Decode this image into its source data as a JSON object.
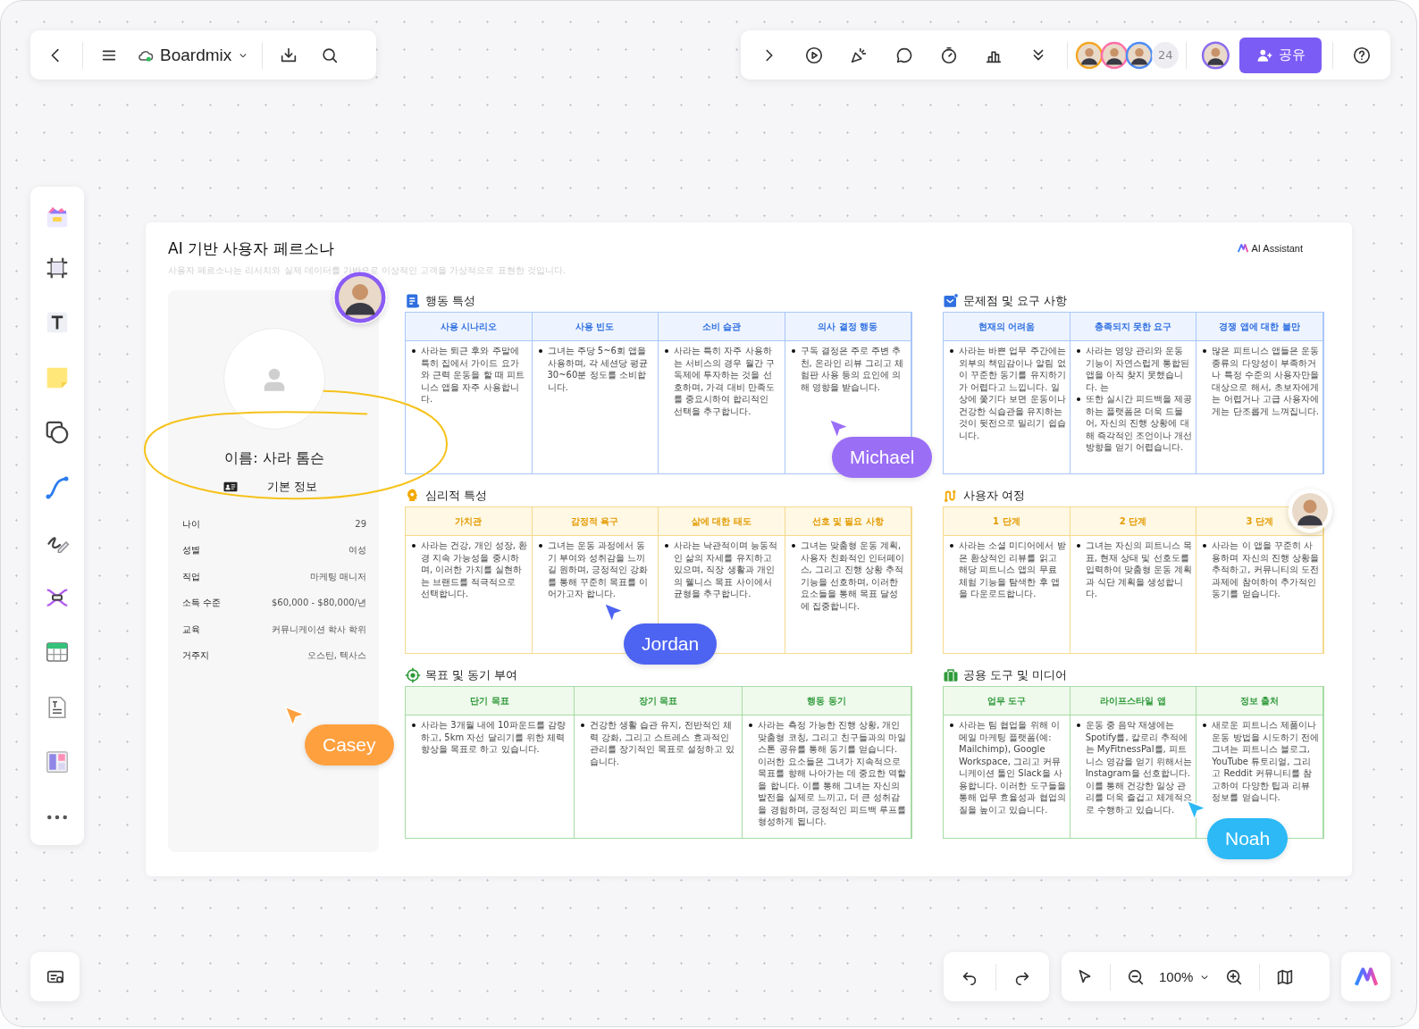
{
  "top_toolbar": {
    "board_name": "Boardmix"
  },
  "collab_bar": {
    "collaborator_count": "24",
    "share_label": "공유"
  },
  "board": {
    "title": "AI 기반 사용자 페르소나",
    "subtitle": "사용자 페르소나는 리서치와 실제 데이터를 기반으로 이상적인 고객을 가상적으로 표현한 것입니다.",
    "assistant_label": "AI Assistant",
    "profile": {
      "name": "이름: 사라 톰슨",
      "section_label": "기본 정보",
      "fields": [
        {
          "label": "나이",
          "value": "29"
        },
        {
          "label": "성별",
          "value": "여성"
        },
        {
          "label": "직업",
          "value": "마케팅 매니저"
        },
        {
          "label": "소득 수준",
          "value": "$60,000 - $80,000/년"
        },
        {
          "label": "교육",
          "value": "커뮤니케이션 학사 학위"
        },
        {
          "label": "거주지",
          "value": "오스틴, 텍사스"
        }
      ]
    },
    "sections": [
      {
        "title": "행동 특성",
        "columns": [
          {
            "heading": "사용 시나리오",
            "bullets": [
              "사라는 퇴근 후와 주말에 특히 집에서 가이드 요가와 근력 운동을 할 때 피트니스 앱을 자주 사용합니다."
            ]
          },
          {
            "heading": "사용 빈도",
            "bullets": [
              "그녀는 주당 5~6회 앱을 사용하며, 각 세션당 평균 30~60분 정도를 소비합니다."
            ]
          },
          {
            "heading": "소비 습관",
            "bullets": [
              "사라는 특히 자주 사용하는 서비스의 경우 월간 구독제에 투자하는 것을 선호하며, 가격 대비 만족도를 중요시하여 합리적인 선택을 추구합니다."
            ]
          },
          {
            "heading": "의사 결정 행동",
            "bullets": [
              "구독 결정은 주로 주변 추천, 온라인 리뷰 그리고 체험판 사용 등의 요인에 의해 영향을 받습니다."
            ]
          }
        ]
      },
      {
        "title": "문제점 및 요구 사항",
        "columns": [
          {
            "heading": "현재의 어려움",
            "bullets": [
              "사라는 바쁜 업무 주간에는 외부의 책임감이나 알림 없이 꾸준한 동기를 유지하기가 어렵다고 느낍니다. 일상에 쫓기다 보면 운동이나 건강한 식습관을 유지하는 것이 뒷전으로 밀리기 쉽습니다."
            ]
          },
          {
            "heading": "충족되지 못한 요구",
            "bullets": [
              "사라는 영양 관리와 운동 기능이 자연스럽게 통합된 앱을 아직 찾지 못했습니다. 는",
              "또한 실시간 피드백을 제공하는 플랫폼은 더욱 드물어, 자신의 진행 상황에 대해 즉각적인 조언이나 개선 방향을 얻기 어렵습니다."
            ]
          },
          {
            "heading": "경쟁 앱에 대한 불만",
            "bullets": [
              "많은 피트니스 앱들은 운동 종류의 다양성이 부족하거나 특정 수준의 사용자만을 대상으로 해서, 초보자에게는 어렵거나 고급 사용자에게는 단조롭게 느껴집니다."
            ]
          }
        ]
      },
      {
        "title": "심리적 특성",
        "columns": [
          {
            "heading": "가치관",
            "bullets": [
              "사라는 건강, 개인 성장, 환경 지속 가능성을 중시하며, 이러한 가치를 실현하는 브랜드를 적극적으로 선택합니다."
            ]
          },
          {
            "heading": "감정적 욕구",
            "bullets": [
              "그녀는 운동 과정에서 동기 부여와 성취감을 느끼길 원하며, 긍정적인 강화를 통해 꾸준히 목표를 이어가고자 합니다."
            ]
          },
          {
            "heading": "삶에 대한 태도",
            "bullets": [
              "사라는 낙관적이며 능동적인 삶의 자세를 유지하고 있으며, 직장 생활과 개인의 웰니스 목표 사이에서 균형을 추구합니다."
            ]
          },
          {
            "heading": "선호 및 필요 사항",
            "bullets": [
              "그녀는 맞춤형 운동 계획, 사용자 친화적인 인터페이스, 그리고 진행 상황 추적 기능을 선호하며, 이러한 요소들을 통해 목표 달성에 집중합니다."
            ]
          }
        ]
      },
      {
        "title": "사용자 여정",
        "columns": [
          {
            "heading": "1 단계",
            "bullets": [
              "사라는 소셜 미디어에서 받은 환상적인 리뷰를 읽고 해당 피트니스 앱의 무료 체험 기능을 탐색한 후 앱을 다운로드합니다."
            ]
          },
          {
            "heading": "2 단계",
            "bullets": [
              "그녀는 자신의 피트니스 목표, 현재 상태 및 선호도를 입력하여 맞춤형 운동 계획과 식단 계획을 생성합니다."
            ]
          },
          {
            "heading": "3 단계",
            "bullets": [
              "사라는 이 앱을 꾸준히 사용하며 자신의 진행 상황을 추적하고, 커뮤니티의 도전 과제에 참여하여 추가적인 동기를 얻습니다."
            ]
          }
        ]
      },
      {
        "title": "목표 및 동기 부여",
        "columns": [
          {
            "heading": "단기 목표",
            "bullets": [
              "사라는 3개월 내에 10파운드를 감량하고, 5km 자선 달리기를 위한 체력 향상을 목표로 하고 있습니다."
            ]
          },
          {
            "heading": "장기 목표",
            "bullets": [
              "건강한 생활 습관 유지, 전반적인 체력 강화, 그리고 스트레스 효과적인 관리를 장기적인 목표로 설정하고 있습니다."
            ]
          },
          {
            "heading": "행동 동기",
            "bullets": [
              "사라는 측정 가능한 진행 상황, 개인 맞춤형 코칭, 그리고 친구들과의 마일스톤 공유를 통해 동기를 얻습니다. 이러한 요소들은 그녀가 지속적으로 목표를 향해 나아가는 데 중요한 역할을 합니다. 이를 통해 그녀는 자신의 발전을 실제로 느끼고, 더 큰 성취감을 경험하며, 긍정적인 피드백 루프를 형성하게 됩니다."
            ]
          }
        ]
      },
      {
        "title": "공용 도구 및 미디어",
        "columns": [
          {
            "heading": "업무 도구",
            "bullets": [
              "사라는 팀 협업을 위해 이메일 마케팅 플랫폼(예: Mailchimp), Google Workspace, 그리고 커뮤니케이션 툴인 Slack을 사용합니다. 이러한 도구들을 통해 업무 효율성과 협업의 질을 높이고 있습니다."
            ]
          },
          {
            "heading": "라이프스타일 앱",
            "bullets": [
              "운동 중 음악 재생에는 Spotify를, 칼로리 추적에는 MyFitnessPal를, 피트니스 영감을 얻기 위해서는 Instagram을 선호합니다. 이를 통해 건강한 일상 관리를 더욱 즐겁고 체계적으로 수행하고 있습니다."
            ]
          },
          {
            "heading": "정보 출처",
            "bullets": [
              "새로운 피트니스 제품이나 운동 방법을 시도하기 전에 그녀는 피트니스 블로그, YouTube 튜토리얼, 그리고 Reddit 커뮤니티를 참고하여 다양한 팁과 리뷰 정보를 얻습니다."
            ]
          }
        ]
      }
    ]
  },
  "cursors": [
    {
      "name": "Michael",
      "color": "#9b6ef6"
    },
    {
      "name": "Jordan",
      "color": "#4d63f2"
    },
    {
      "name": "Casey",
      "color": "#ffa03f"
    },
    {
      "name": "Noah",
      "color": "#2cb9f6"
    }
  ],
  "zoom_bar": {
    "zoom_text": "100%"
  }
}
